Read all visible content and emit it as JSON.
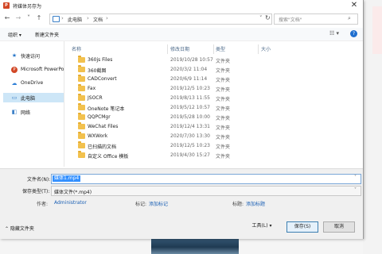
{
  "window": {
    "title": "将媒体另存为",
    "close_glyph": "✕"
  },
  "nav": {
    "back": "←",
    "forward": "→",
    "dropdown": "˅",
    "up": "↑"
  },
  "address": {
    "crumbs": [
      "此电脑",
      "文档"
    ],
    "separator": "›",
    "dropdown": "˅",
    "refresh": "↻"
  },
  "search": {
    "placeholder": "搜索\"文档\"",
    "icon": "⌕"
  },
  "toolbar": {
    "organize": "组织 ▾",
    "new_folder": "新建文件夹",
    "view_glyph": "☷ ▾",
    "help_glyph": "?"
  },
  "sidebar": {
    "items": [
      {
        "label": "快速访问",
        "icon": "star-icon",
        "glyph": "★",
        "color": "#2b78c9"
      },
      {
        "label": "Microsoft PowerPo",
        "icon": "powerpoint-icon",
        "glyph": "P",
        "color": "#d24726"
      },
      {
        "label": "OneDrive",
        "icon": "cloud-icon",
        "glyph": "☁",
        "color": "#2f7fd6"
      },
      {
        "label": "此电脑",
        "icon": "computer-icon",
        "glyph": "▭",
        "color": "#3a7fc7"
      },
      {
        "label": "网络",
        "icon": "network-icon",
        "glyph": "◧",
        "color": "#3a7fc7"
      }
    ],
    "selected_index": 3
  },
  "columns": {
    "name": "名称",
    "date": "修改日期",
    "type": "类型",
    "size": "大小"
  },
  "files": [
    {
      "name": "360js Files",
      "date": "2019/10/28 10:57",
      "type": "文件夹"
    },
    {
      "name": "360截图",
      "date": "2020/3/2 11:04",
      "type": "文件夹"
    },
    {
      "name": "CADConvert",
      "date": "2020/6/9 11:14",
      "type": "文件夹"
    },
    {
      "name": "Fax",
      "date": "2019/12/5 10:23",
      "type": "文件夹"
    },
    {
      "name": "JSOCR",
      "date": "2019/8/13 11:55",
      "type": "文件夹"
    },
    {
      "name": "OneNote 笔记本",
      "date": "2019/5/12 10:57",
      "type": "文件夹"
    },
    {
      "name": "QQPCMgr",
      "date": "2019/5/28 10:00",
      "type": "文件夹"
    },
    {
      "name": "WeChat Files",
      "date": "2019/12/4 13:31",
      "type": "文件夹"
    },
    {
      "name": "WXWork",
      "date": "2020/7/30 13:30",
      "type": "文件夹"
    },
    {
      "name": "已扫描的文档",
      "date": "2019/12/5 10:23",
      "type": "文件夹"
    },
    {
      "name": "自定义 Office 模板",
      "date": "2019/4/30 15:27",
      "type": "文件夹"
    }
  ],
  "form": {
    "filename_label": "文件名(N):",
    "filename_value": "媒体1.mp4",
    "savetype_label": "保存类型(T):",
    "savetype_value": "媒体文件(*.mp4)",
    "dropdown": "˅",
    "author_label": "作者:",
    "author_value": "Administrator",
    "tags_label": "标记:",
    "tags_value": "添加标记",
    "title_label": "标题:",
    "title_value": "添加标题"
  },
  "footer": {
    "hide_folders": "⌃ 隐藏文件夹",
    "tools": "工具(L) ▾",
    "save": "保存(S)",
    "cancel": "取消"
  }
}
